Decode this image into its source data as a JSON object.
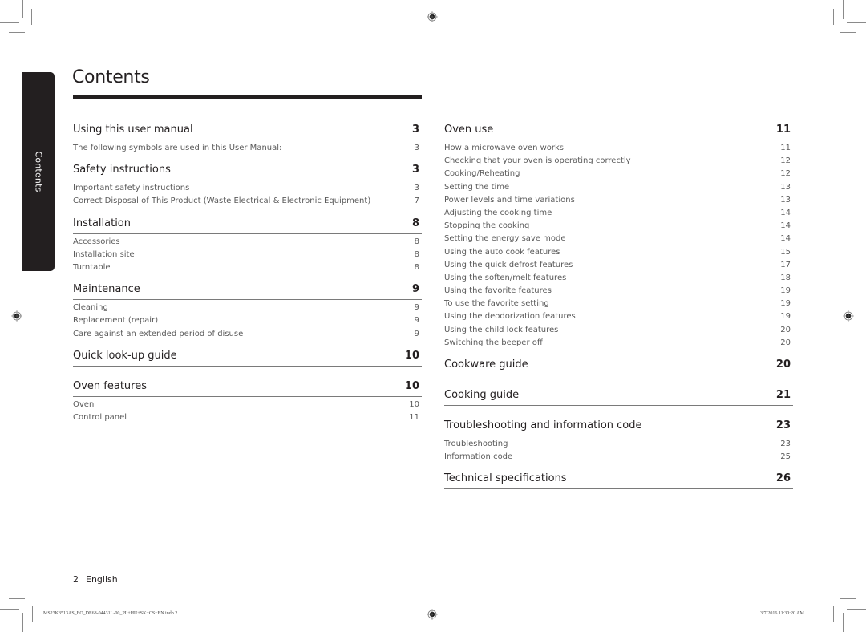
{
  "sidebar_tab": {
    "label": "Contents"
  },
  "page": {
    "title": "Contents"
  },
  "left_column": [
    {
      "title": "Using this user manual",
      "page": "3",
      "entries": [
        {
          "label": "The following symbols are used in this User Manual:",
          "page": "3"
        }
      ]
    },
    {
      "title": "Safety instructions",
      "page": "3",
      "entries": [
        {
          "label": "Important safety instructions",
          "page": "3"
        },
        {
          "label": "Correct Disposal of This Product (Waste Electrical & Electronic Equipment)",
          "page": "7"
        }
      ]
    },
    {
      "title": "Installation",
      "page": "8",
      "entries": [
        {
          "label": "Accessories",
          "page": "8"
        },
        {
          "label": "Installation site",
          "page": "8"
        },
        {
          "label": "Turntable",
          "page": "8"
        }
      ]
    },
    {
      "title": "Maintenance",
      "page": "9",
      "entries": [
        {
          "label": "Cleaning",
          "page": "9"
        },
        {
          "label": "Replacement (repair)",
          "page": "9"
        },
        {
          "label": "Care against an extended period of disuse",
          "page": "9"
        }
      ]
    },
    {
      "title": "Quick look-up guide",
      "page": "10",
      "entries": []
    },
    {
      "title": "Oven features",
      "page": "10",
      "entries": [
        {
          "label": "Oven",
          "page": "10"
        },
        {
          "label": "Control panel",
          "page": "11"
        }
      ]
    }
  ],
  "right_column": [
    {
      "title": "Oven use",
      "page": "11",
      "entries": [
        {
          "label": "How a microwave oven works",
          "page": "11"
        },
        {
          "label": "Checking that your oven is operating correctly",
          "page": "12"
        },
        {
          "label": "Cooking/Reheating",
          "page": "12"
        },
        {
          "label": "Setting the time",
          "page": "13"
        },
        {
          "label": "Power levels and time variations",
          "page": "13"
        },
        {
          "label": "Adjusting the cooking time",
          "page": "14"
        },
        {
          "label": "Stopping the cooking",
          "page": "14"
        },
        {
          "label": "Setting the energy save mode",
          "page": "14"
        },
        {
          "label": "Using the auto cook features",
          "page": "15"
        },
        {
          "label": "Using the quick defrost features",
          "page": "17"
        },
        {
          "label": "Using the soften/melt features",
          "page": "18"
        },
        {
          "label": "Using the favorite features",
          "page": "19"
        },
        {
          "label": "To use the favorite setting",
          "page": "19"
        },
        {
          "label": "Using the deodorization features",
          "page": "19"
        },
        {
          "label": "Using the child lock features",
          "page": "20"
        },
        {
          "label": "Switching the beeper off",
          "page": "20"
        }
      ]
    },
    {
      "title": "Cookware guide",
      "page": "20",
      "entries": []
    },
    {
      "title": "Cooking guide",
      "page": "21",
      "entries": []
    },
    {
      "title": "Troubleshooting and information code",
      "page": "23",
      "entries": [
        {
          "label": "Troubleshooting",
          "page": "23"
        },
        {
          "label": "Information code",
          "page": "25"
        }
      ]
    },
    {
      "title": "Technical specifications",
      "page": "26",
      "entries": []
    }
  ],
  "footer": {
    "page_number": "2",
    "language": "English",
    "file_name": "MS23K3513AS_EO_DE68-04431L-00_PL+HU+SK+CS+EN.indb   2",
    "timestamp": "3/7/2016   11:30:20 AM"
  },
  "icons": {
    "registration_mark": "crosshair-circle",
    "crop_mark": "corner-lines"
  }
}
